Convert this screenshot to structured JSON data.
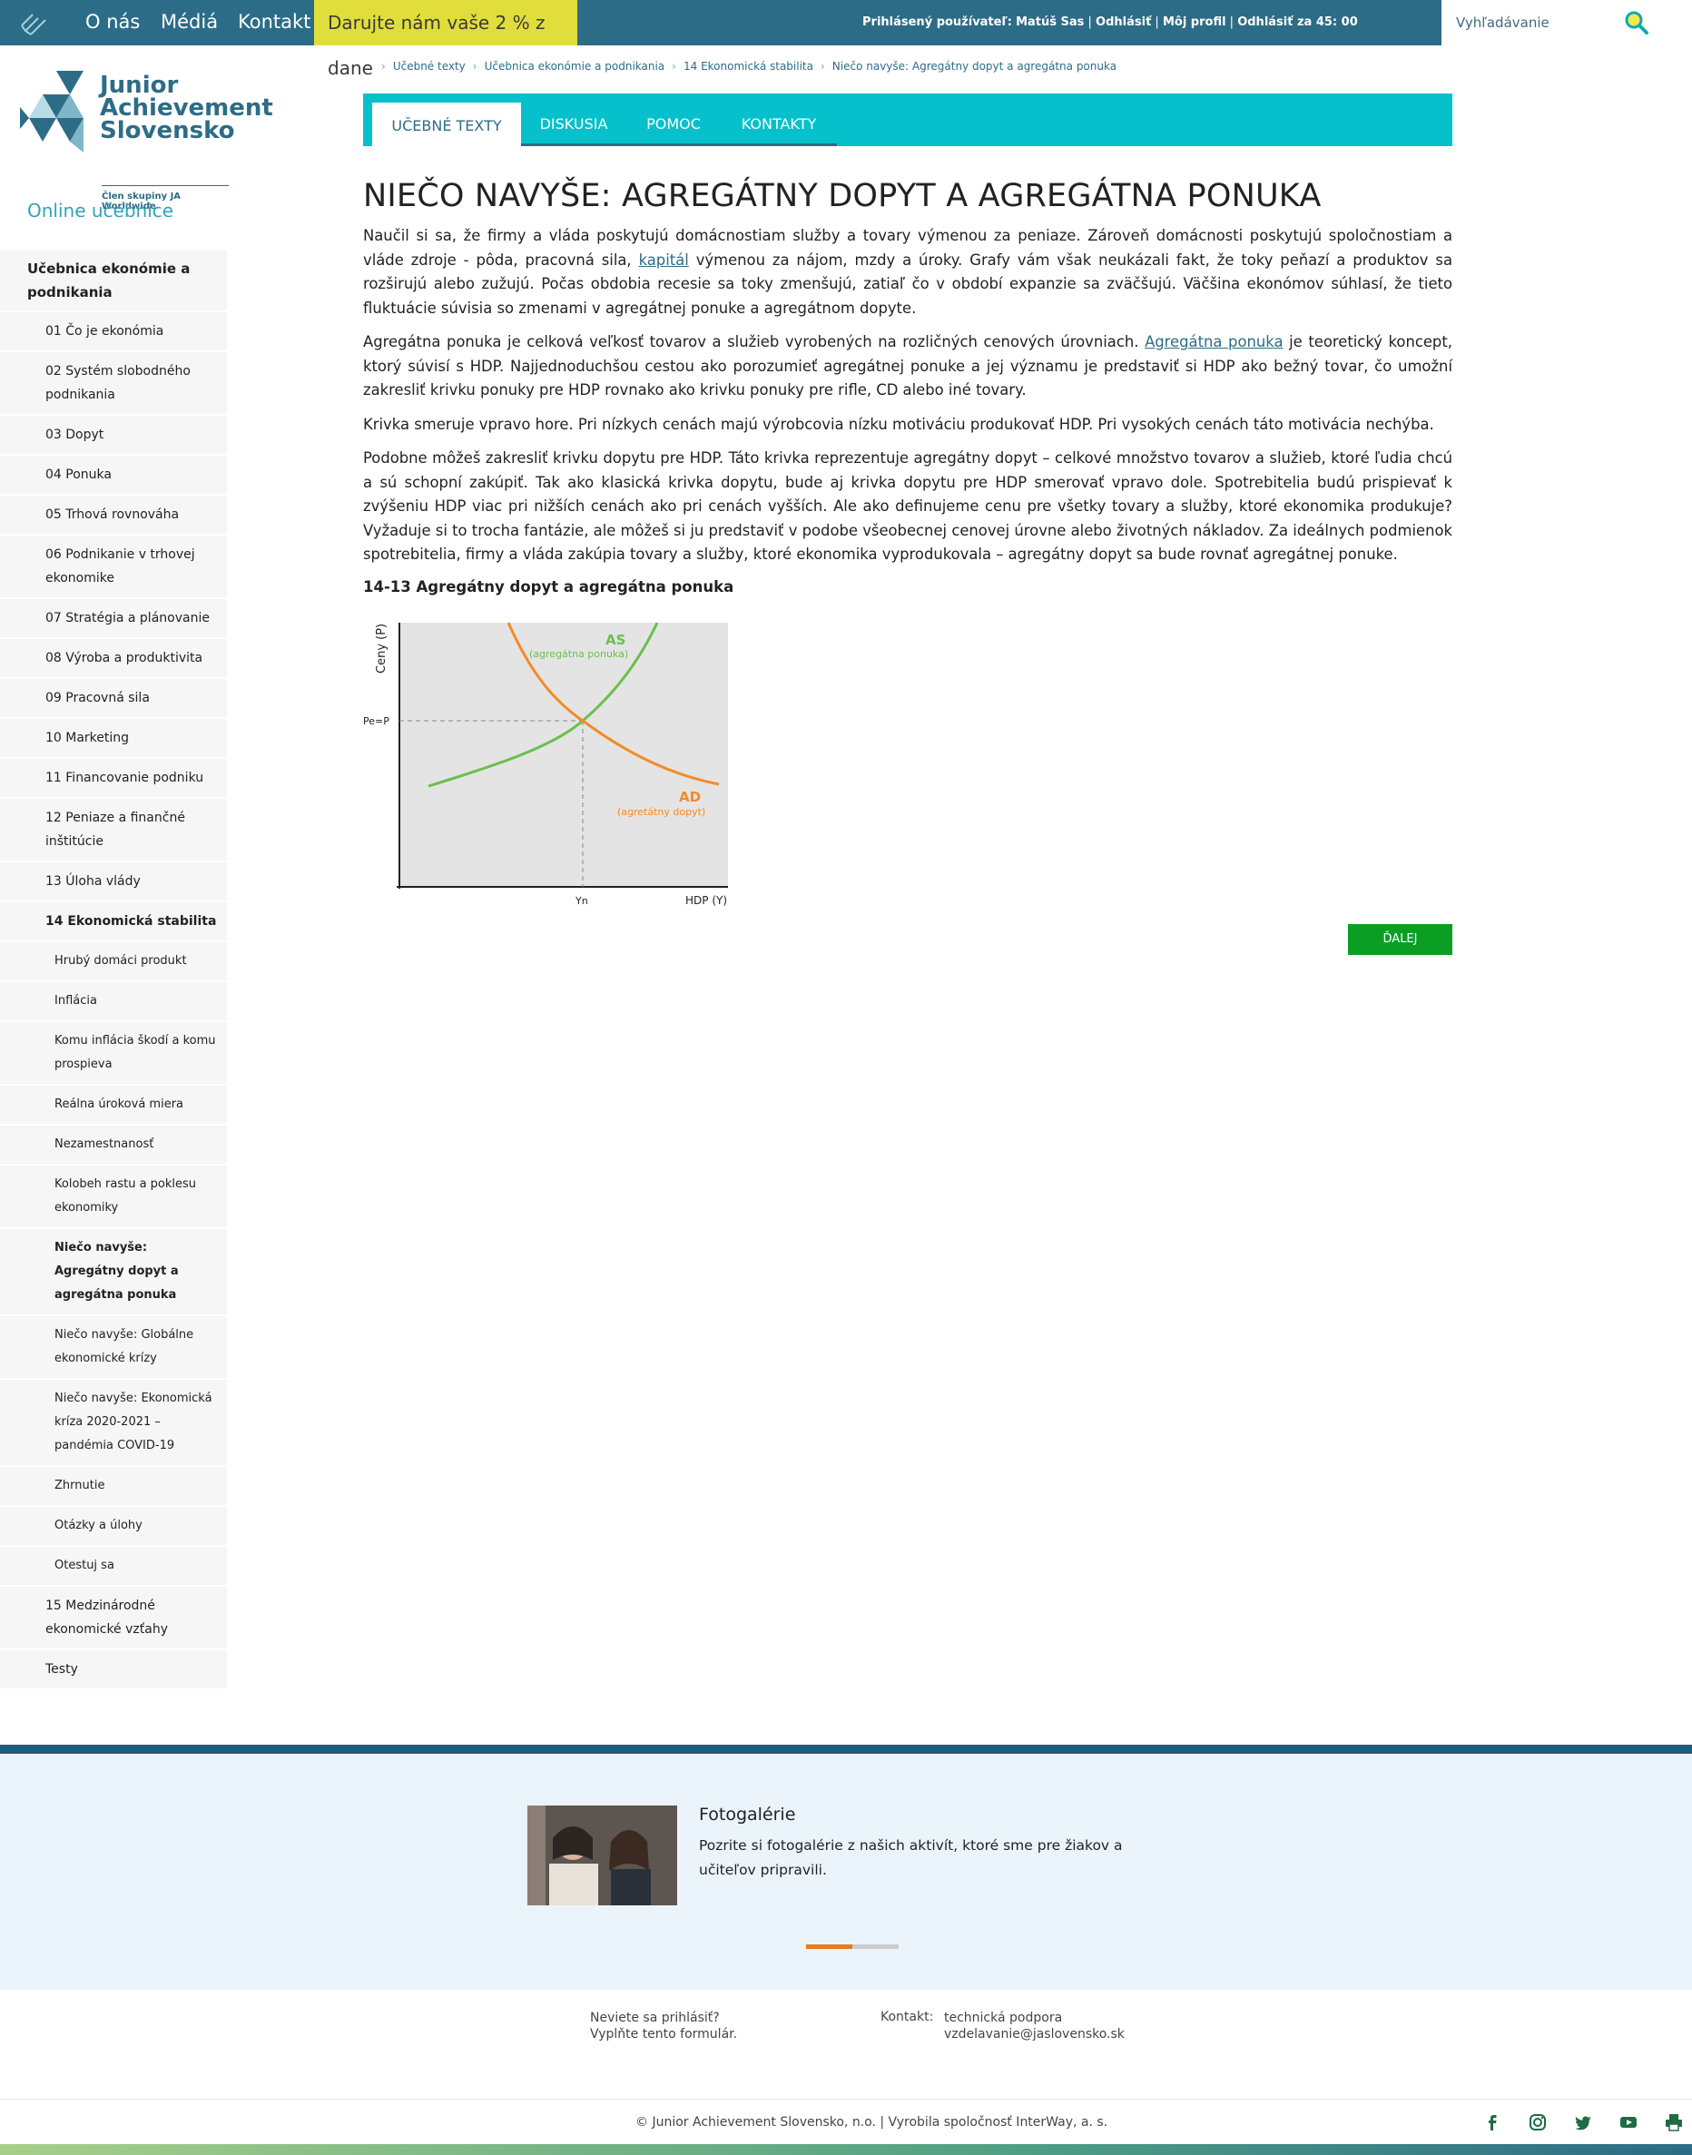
{
  "topbar": {
    "nav": [
      "O nás",
      "Médiá",
      "Kontakt"
    ],
    "donate": "Darujte nám vaše 2 % z dane",
    "user_label": "Prihlásený používateľ:",
    "user_name": "Matúš Sas",
    "logout": "Odhlásiť",
    "profile": "Môj profil",
    "logout_timer": "Odhlásiť za 45: 00",
    "search_placeholder": "Vyhľadávanie"
  },
  "brand": {
    "name_line1": "Junior",
    "name_line2": "Achievement",
    "name_line3": "Slovensko",
    "tagline": "Člen skupiny JA Worldwide"
  },
  "sidebar": {
    "title": "Online učebnice",
    "items": [
      {
        "label": "Učebnica ekonómie a podnikania",
        "level": 0
      },
      {
        "label": "01 Čo je ekonómia",
        "level": 1
      },
      {
        "label": "02 Systém slobodného podnikania",
        "level": 1
      },
      {
        "label": "03 Dopyt",
        "level": 1
      },
      {
        "label": "04 Ponuka",
        "level": 1
      },
      {
        "label": "05 Trhová rovnováha",
        "level": 1
      },
      {
        "label": "06 Podnikanie v trhovej ekonomike",
        "level": 1
      },
      {
        "label": "07 Stratégia a plánovanie",
        "level": 1
      },
      {
        "label": "08 Výroba a produktivita",
        "level": 1
      },
      {
        "label": "09 Pracovná sila",
        "level": 1
      },
      {
        "label": "10 Marketing",
        "level": 1
      },
      {
        "label": "11 Financovanie podniku",
        "level": 1
      },
      {
        "label": "12 Peniaze a finančné inštitúcie",
        "level": 1
      },
      {
        "label": "13 Úloha vlády",
        "level": 1
      },
      {
        "label": "14 Ekonomická stabilita",
        "level": 1,
        "active": true
      },
      {
        "label": "Hrubý domáci produkt",
        "level": 2
      },
      {
        "label": "Inflácia",
        "level": 2
      },
      {
        "label": "Komu inflácia škodí a komu prospieva",
        "level": 2
      },
      {
        "label": "Reálna úroková miera",
        "level": 2
      },
      {
        "label": "Nezamestnanosť",
        "level": 2
      },
      {
        "label": "Kolobeh rastu a poklesu ekonomiky",
        "level": 2
      },
      {
        "label": "Niečo navyše: Agregátny dopyt a agregátna ponuka",
        "level": 2,
        "active": true
      },
      {
        "label": "Niečo navyše: Globálne ekonomické krízy",
        "level": 2
      },
      {
        "label": "Niečo navyše: Ekonomická kríza 2020-2021 – pandémia COVID-19",
        "level": 2
      },
      {
        "label": "Zhrnutie",
        "level": 2
      },
      {
        "label": "Otázky a úlohy",
        "level": 2
      },
      {
        "label": "Otestuj sa",
        "level": 2
      },
      {
        "label": "15 Medzinárodné ekonomické vzťahy",
        "level": 1
      },
      {
        "label": "Testy",
        "level": 1
      }
    ]
  },
  "breadcrumb": [
    "Učebné texty",
    "Učebnica ekonómie a podnikania",
    "14 Ekonomická stabilita",
    "Niečo navyše: Agregátny dopyt a agregátna ponuka"
  ],
  "tabs": [
    "UČEBNÉ TEXTY",
    "DISKUSIA",
    "POMOC",
    "KONTAKTY"
  ],
  "article": {
    "title": "NIEČO NAVYŠE: AGREGÁTNY DOPYT A AGREGÁTNA PONUKA",
    "p1_a": "Naučil si sa, že firmy a vláda poskytujú domácnostiam služby a tovary výmenou za peniaze. Zároveň domácnosti poskytujú spoločnostiam a vláde zdroje - pôda, pracovná sila, ",
    "p1_link": "kapitál",
    "p1_b": " výmenou za nájom, mzdy a úroky. Grafy vám však neukázali fakt, že toky peňazí a produktov sa rozširujú alebo zužujú. Počas obdobia recesie sa toky zmenšujú, zatiaľ čo v období expanzie sa zväčšujú. Väčšina ekonómov súhlasí, že tieto fluktuácie súvisia so zmenami v agregátnej ponuke a agregátnom dopyte.",
    "p2_a": "Agregátna ponuka je celková veľkosť tovarov a služieb vyrobených na rozličných cenových úrovniach. ",
    "p2_link": "Agregátna ponuka",
    "p2_b": " je teoretický koncept, ktorý súvisí s HDP. Najjednoduchšou cestou ako porozumieť agregátnej ponuke a jej významu je predstaviť si HDP ako bežný tovar, čo umožní zakresliť krivku ponuky pre HDP rovnako ako krivku ponuky pre rifle, CD alebo iné tovary.",
    "p3": "Krivka smeruje vpravo hore. Pri nízkych cenách majú výrobcovia nízku motiváciu produkovať HDP. Pri vysokých cenách táto motivácia nechýba.",
    "p4": "Podobne môžeš zakresliť krivku dopytu pre HDP. Táto krivka reprezentuje agregátny dopyt – celkové množstvo tovarov a služieb, ktoré ľudia chcú a sú schopní zakúpiť. Tak ako klasická krivka dopytu, bude aj krivka dopytu pre HDP smerovať vpravo dole. Spotrebitelia budú prispievať k zvýšeniu HDP viac pri nižších cenách ako pri cenách vyšších. Ale ako definujeme cenu pre všetky tovary a služby, ktoré ekonomika produkuje? Vyžaduje si to trocha fantázie, ale môžeš si ju predstaviť v podobe všeobecnej cenovej úrovne alebo životných nákladov. Za ideálnych podmienok spotrebitelia, firmy a vláda zakúpia tovary a služby, ktoré ekonomika vyprodukovala – agregátny dopyt sa bude rovnať agregátnej ponuke.",
    "figure_title": "14-13 Agregátny dopyt a agregátna ponuka",
    "next": "ĎALEJ"
  },
  "chart_data": {
    "type": "line",
    "ylabel": "Ceny (P)",
    "xlabel": "HDP (Y)",
    "x_tick": "Yn",
    "y_tick": "Pe=P",
    "series": [
      {
        "name": "AS",
        "sublabel": "(agregátna ponuka)",
        "color": "#6abf4b",
        "shape": "increasing convex"
      },
      {
        "name": "AD",
        "sublabel": "(agretátny dopyt)",
        "color": "#f28c28",
        "shape": "decreasing convex"
      }
    ],
    "equilibrium": {
      "x": "Yn",
      "y": "Pe=P"
    },
    "grid": false,
    "background": "#e4e4e4"
  },
  "gallery": {
    "title": "Fotogalérie",
    "desc": "Pozrite si fotogalérie z našich aktivít, ktoré sme pre žiakov a učiteľov pripravili.",
    "progress": 0.5
  },
  "footer": {
    "login_q": "Neviete sa prihlásiť?",
    "login_form": "Vyplňte tento formulár.",
    "contact_label": "Kontakt:",
    "contact_support": "technická podpora",
    "contact_email": "vzdelavanie@jaslovensko.sk",
    "copyright": "© Junior Achievement Slovensko, n.o. | Vyrobila spoločnosť InterWay, a. s.",
    "social": [
      "facebook-icon",
      "instagram-icon",
      "twitter-icon",
      "youtube-icon",
      "print-icon"
    ]
  },
  "colors": {
    "primary": "#2d6c86",
    "accent": "#06c1cc",
    "donate": "#e1dd3a",
    "button": "#0a9f23"
  }
}
